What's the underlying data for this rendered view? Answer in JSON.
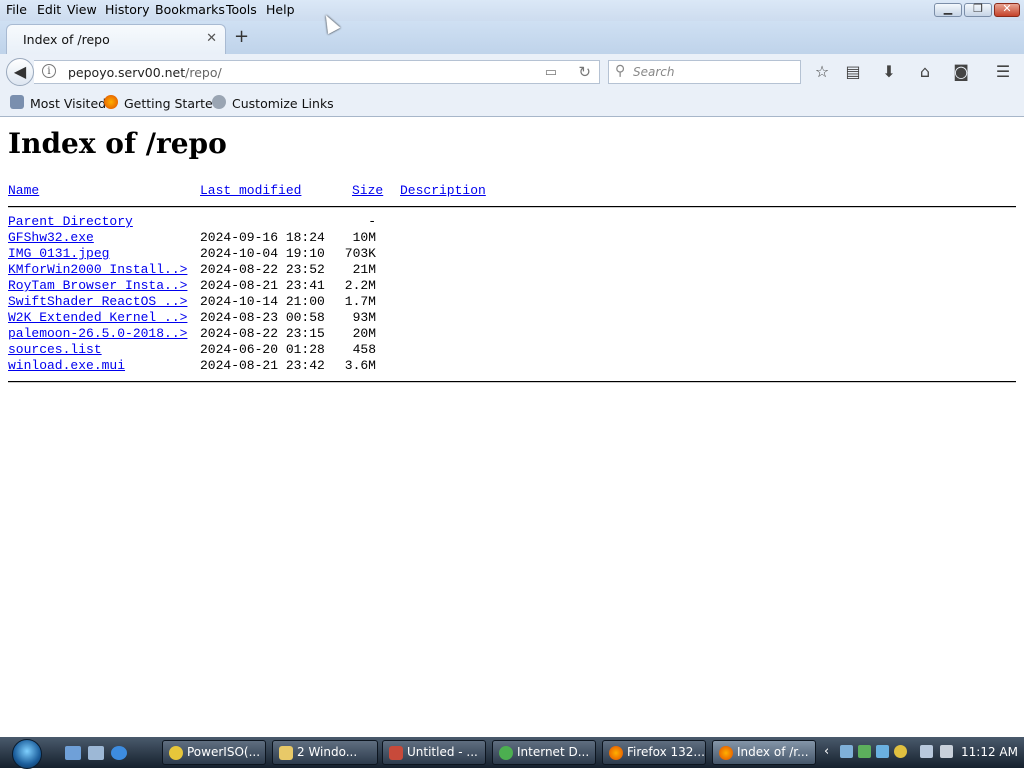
{
  "menubar": {
    "items": [
      {
        "label": "File"
      },
      {
        "label": "Edit"
      },
      {
        "label": "View"
      },
      {
        "label": "History"
      },
      {
        "label": "Bookmarks"
      },
      {
        "label": "Tools"
      },
      {
        "label": "Help"
      }
    ]
  },
  "window_controls": {
    "minimize": "▁",
    "maximize": "❐",
    "close": "✕"
  },
  "tab": {
    "title": "Index of /repo",
    "close_glyph": "✕",
    "new_tab_glyph": "+"
  },
  "navbar": {
    "url_host": "pepoyo.serv00.net",
    "url_path": "/repo/",
    "search_placeholder": "Search",
    "icons": [
      "back-icon",
      "info-icon",
      "reader-icon",
      "reload-icon",
      "search-icon",
      "star-icon",
      "library-icon",
      "download-icon",
      "home-icon",
      "pocket-icon",
      "menu-icon"
    ]
  },
  "bookmarks": {
    "items": [
      {
        "label": "Most Visited",
        "icon": "bookmarks-folder-icon"
      },
      {
        "label": "Getting Started",
        "icon": "firefox-icon"
      },
      {
        "label": "Customize Links",
        "icon": "globe-icon"
      }
    ]
  },
  "page": {
    "heading": "Index of /repo",
    "columns": {
      "name": "Name",
      "modified": "Last modified",
      "size": "Size",
      "description": "Description"
    },
    "parent": {
      "name": "Parent Directory",
      "size": "-"
    },
    "files": [
      {
        "name": "GFShw32.exe",
        "date": "2024-09-16 18:24",
        "size": "10M"
      },
      {
        "name": "IMG_0131.jpeg",
        "date": "2024-10-04 19:10",
        "size": "703K"
      },
      {
        "name": "KMforWin2000 Install..>",
        "date": "2024-08-22 23:52",
        "size": "21M"
      },
      {
        "name": "RoyTam Browser Insta..>",
        "date": "2024-08-21 23:41",
        "size": "2.2M"
      },
      {
        "name": "SwiftShader ReactOS ..>",
        "date": "2024-10-14 21:00",
        "size": "1.7M"
      },
      {
        "name": "W2K Extended Kernel ..>",
        "date": "2024-08-23 00:58",
        "size": "93M"
      },
      {
        "name": "palemoon-26.5.0-2018..>",
        "date": "2024-08-22 23:15",
        "size": "20M"
      },
      {
        "name": "sources.list",
        "date": "2024-06-20 01:28",
        "size": "458"
      },
      {
        "name": "winload.exe.mui",
        "date": "2024-08-21 23:42",
        "size": "3.6M"
      }
    ]
  },
  "taskbar": {
    "tasks": [
      {
        "label": "PowerISO(...",
        "icon": "poweriso-icon",
        "active": false
      },
      {
        "label": "2 Windo...",
        "icon": "folder-icon",
        "active": false
      },
      {
        "label": "Untitled - ...",
        "icon": "editor-icon",
        "active": false
      },
      {
        "label": "Internet D...",
        "icon": "internet-download-icon",
        "active": false
      },
      {
        "label": "Firefox 132...",
        "icon": "firefox-icon",
        "active": false
      },
      {
        "label": "Index of /r...",
        "icon": "firefox-icon",
        "active": true
      }
    ],
    "clock": "11:12 AM"
  },
  "colors": {
    "link": "#0000ee",
    "chrome": "#eaf0f8",
    "taskbar": "#1b2634"
  }
}
